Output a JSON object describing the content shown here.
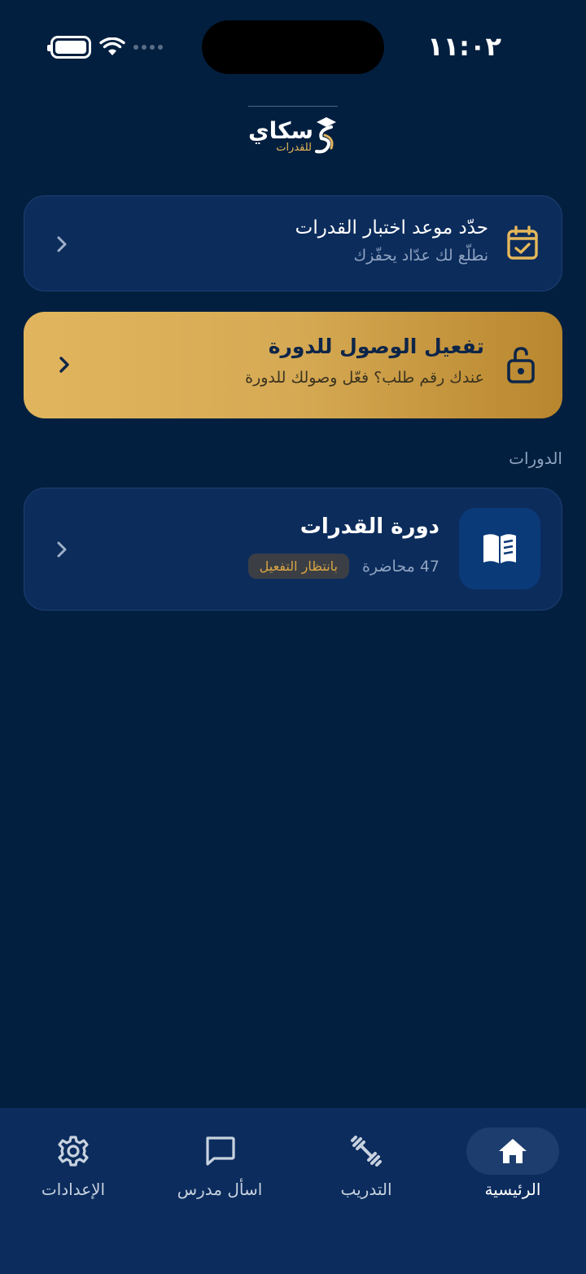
{
  "status_bar": {
    "time": "١١:٠٢"
  },
  "logo": {
    "wordmark": "سكاي",
    "subtitle": "للقدرات"
  },
  "schedule_card": {
    "title": "حدّد موعد اختبار القدرات",
    "subtitle": "نطلّع لك عدّاد يحفّزك",
    "icon": "calendar-check-icon"
  },
  "activate_card": {
    "title": "تفعيل الوصول للدورة",
    "subtitle": "عندك رقم طلب؟ فعّل وصولك للدورة",
    "icon": "unlock-icon"
  },
  "courses_section": {
    "title": "الدورات",
    "items": [
      {
        "title": "دورة القدرات",
        "lectures": "47 محاضرة",
        "badge": "بانتظار التفعيل",
        "icon": "book-icon"
      }
    ]
  },
  "bottom_nav": {
    "items": [
      {
        "label": "الرئيسية",
        "icon": "home-icon",
        "active": true
      },
      {
        "label": "التدريب",
        "icon": "dumbbell-icon",
        "active": false
      },
      {
        "label": "اسأل مدرس",
        "icon": "chat-icon",
        "active": false
      },
      {
        "label": "الإعدادات",
        "icon": "gear-icon",
        "active": false
      }
    ]
  },
  "colors": {
    "background": "#031f3f",
    "card": "#0c2c5c",
    "accent_gold": "#d6aa54",
    "nav_background": "#0b2c5d"
  }
}
